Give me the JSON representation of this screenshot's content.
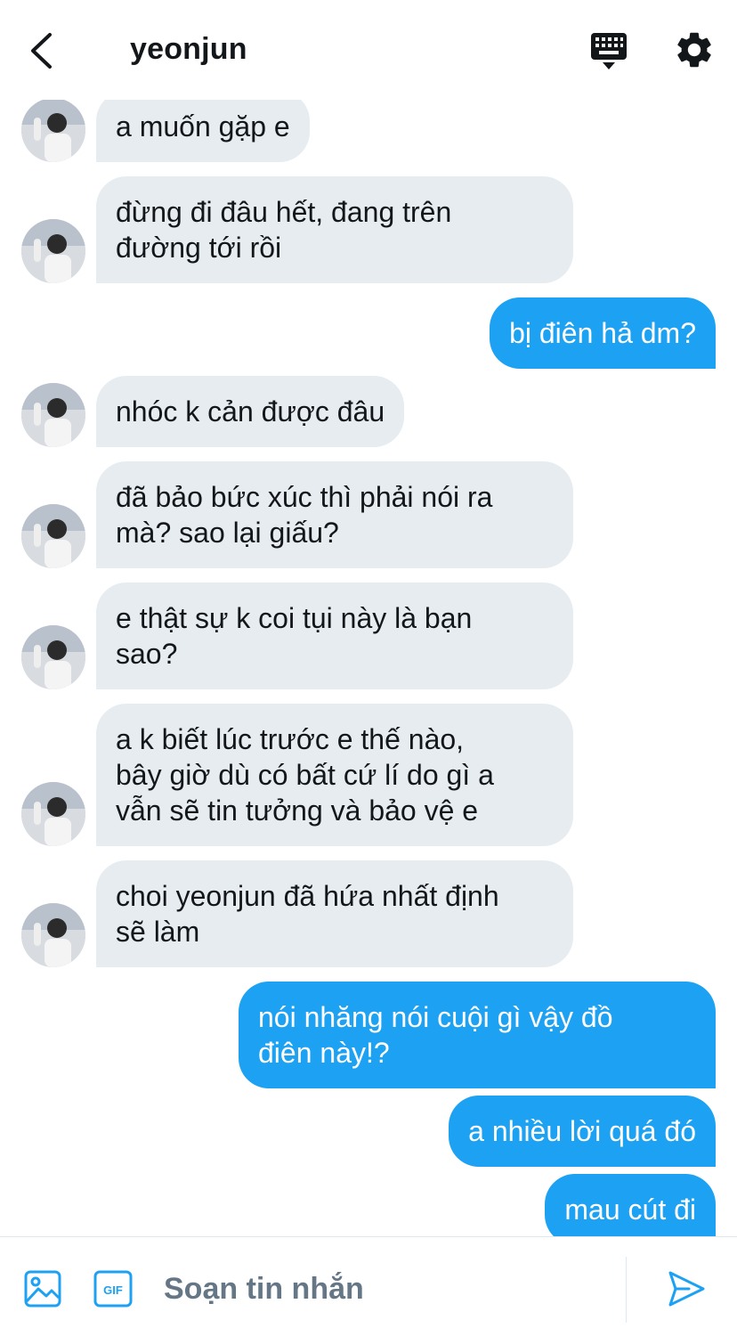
{
  "header": {
    "title": "yeonjun",
    "icons": {
      "back": "chevron-left-icon",
      "keyboard": "keyboard-icon",
      "settings": "gear-icon"
    }
  },
  "messages": [
    {
      "dir": "in",
      "text": "a muốn gặp e"
    },
    {
      "dir": "in",
      "text": "đừng đi đâu hết, đang trên\nđường tới rồi"
    },
    {
      "dir": "out",
      "text": "bị điên hả dm?"
    },
    {
      "dir": "in",
      "text": "nhóc k cản được đâu"
    },
    {
      "dir": "in",
      "text": "đã bảo bức xúc thì phải nói ra\nmà? sao lại giấu?"
    },
    {
      "dir": "in",
      "text": "e thật sự k coi tụi này là bạn\nsao?"
    },
    {
      "dir": "in",
      "text": "a k biết lúc trước e thế nào,\nbây giờ dù có bất cứ lí do gì a\nvẫn sẽ tin tưởng và bảo vệ e"
    },
    {
      "dir": "in",
      "text": "choi yeonjun đã hứa nhất định\nsẽ làm"
    },
    {
      "dir": "out",
      "text": "nói nhăng nói cuội gì vậy đồ\nđiên này!?"
    },
    {
      "dir": "out",
      "text": "a nhiều lời quá đó"
    },
    {
      "dir": "out",
      "text": "mau cút đi"
    }
  ],
  "composer": {
    "placeholder": "Soạn tin nhắn",
    "value": "",
    "icons": {
      "image": "image-icon",
      "gif": "gif-icon",
      "send": "send-icon"
    }
  },
  "colors": {
    "accent": "#1da1f2",
    "incoming_bubble": "#e6ecf0",
    "text": "#14171a",
    "muted": "#657786"
  }
}
